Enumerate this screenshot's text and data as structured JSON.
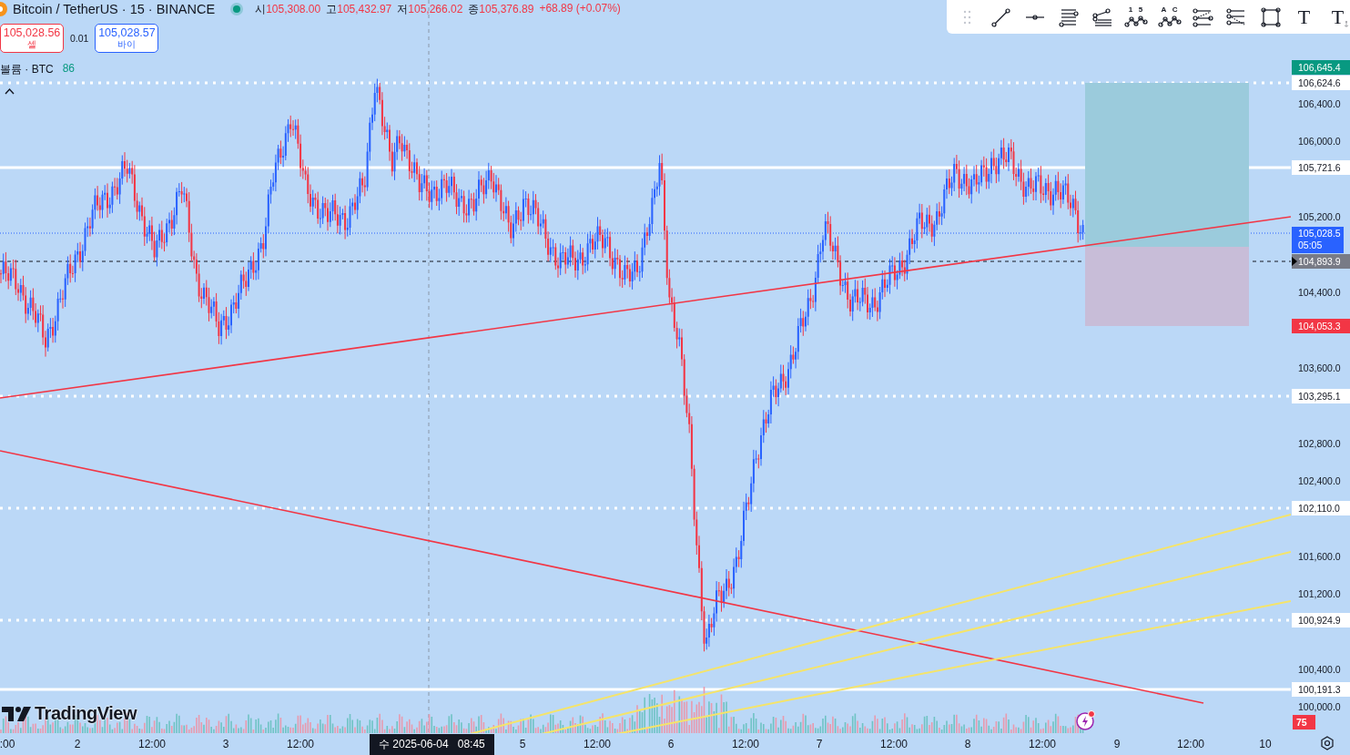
{
  "header": {
    "symbol": "Bitcoin / TetherUS · 15 · BINANCE",
    "ohlc": [
      {
        "label": "시",
        "value": "105,308.00"
      },
      {
        "label": "고",
        "value": "105,432.97"
      },
      {
        "label": "저",
        "value": "105,266.02"
      },
      {
        "label": "종",
        "value": "105,376.89"
      }
    ],
    "change": "+68.89 (+0.07%)"
  },
  "trade": {
    "sell": {
      "price": "105,028.56",
      "label": "셀"
    },
    "spread": "0.01",
    "buy": {
      "price": "105,028.57",
      "label": "바이"
    }
  },
  "volume_legend": {
    "label": "볼륨 · BTC",
    "value": "86"
  },
  "toolbar": {
    "tools": [
      {
        "kind": "handle"
      },
      {
        "kind": "trend-line"
      },
      {
        "kind": "horizontal-ray"
      },
      {
        "kind": "parallel-lines"
      },
      {
        "kind": "pitchfork"
      },
      {
        "kind": "wave",
        "marks": [
          "1",
          "5"
        ]
      },
      {
        "kind": "wave",
        "marks": [
          "A",
          "C"
        ]
      },
      {
        "kind": "fib-channel"
      },
      {
        "kind": "fib-channel-alt"
      },
      {
        "kind": "rectangle"
      },
      {
        "kind": "text",
        "marks": [
          "T"
        ]
      },
      {
        "kind": "anchored-text",
        "marks": [
          "T"
        ]
      }
    ]
  },
  "price_axis": {
    "labels": [
      {
        "text": "106,645.4",
        "kind": "tag",
        "color": "#089981"
      },
      {
        "text": "106,624.6",
        "kind": "marker"
      },
      {
        "text": "106,400.0",
        "kind": "plain"
      },
      {
        "text": "106,000.0",
        "kind": "plain"
      },
      {
        "text": "105,721.6",
        "kind": "marker"
      },
      {
        "text": "105,200.0",
        "kind": "plain"
      },
      {
        "text": "105,028.5",
        "kind": "current",
        "color": "#2962ff",
        "sub": "05:05"
      },
      {
        "text": "104,893.9",
        "kind": "pointer-tag",
        "color": "#787b86"
      },
      {
        "text": "104,400.0",
        "kind": "plain"
      },
      {
        "text": "104,053.3",
        "kind": "tag",
        "color": "#f23645"
      },
      {
        "text": "103,600.0",
        "kind": "plain"
      },
      {
        "text": "103,295.1",
        "kind": "marker"
      },
      {
        "text": "102,800.0",
        "kind": "plain"
      },
      {
        "text": "102,400.0",
        "kind": "plain"
      },
      {
        "text": "102,110.0",
        "kind": "marker"
      },
      {
        "text": "101,600.0",
        "kind": "plain"
      },
      {
        "text": "101,200.0",
        "kind": "plain"
      },
      {
        "text": "100,924.9",
        "kind": "marker"
      },
      {
        "text": "100,400.0",
        "kind": "plain"
      },
      {
        "text": "100,191.3",
        "kind": "marker"
      },
      {
        "text": "100,000.0",
        "kind": "plain"
      },
      {
        "text": "75",
        "kind": "count",
        "color": "#f23645"
      }
    ]
  },
  "price_lines": [
    {
      "kind": "dotted"
    },
    {
      "kind": "solid"
    },
    {
      "kind": "dotted-fine"
    },
    {
      "kind": "dashed"
    },
    {
      "kind": "dotted"
    },
    {
      "kind": "dotted"
    },
    {
      "kind": "dotted"
    },
    {
      "kind": "solid"
    }
  ],
  "time_axis": {
    "labels": [
      ":00",
      "2",
      "12:00",
      "3",
      "12:00",
      "5",
      "12:00",
      "6",
      "12:00",
      "7",
      "12:00",
      "8",
      "12:00",
      "9",
      "12:00",
      "10"
    ],
    "crosshair": "수 2025-06-04   08:45"
  },
  "logo": "TradingView"
}
